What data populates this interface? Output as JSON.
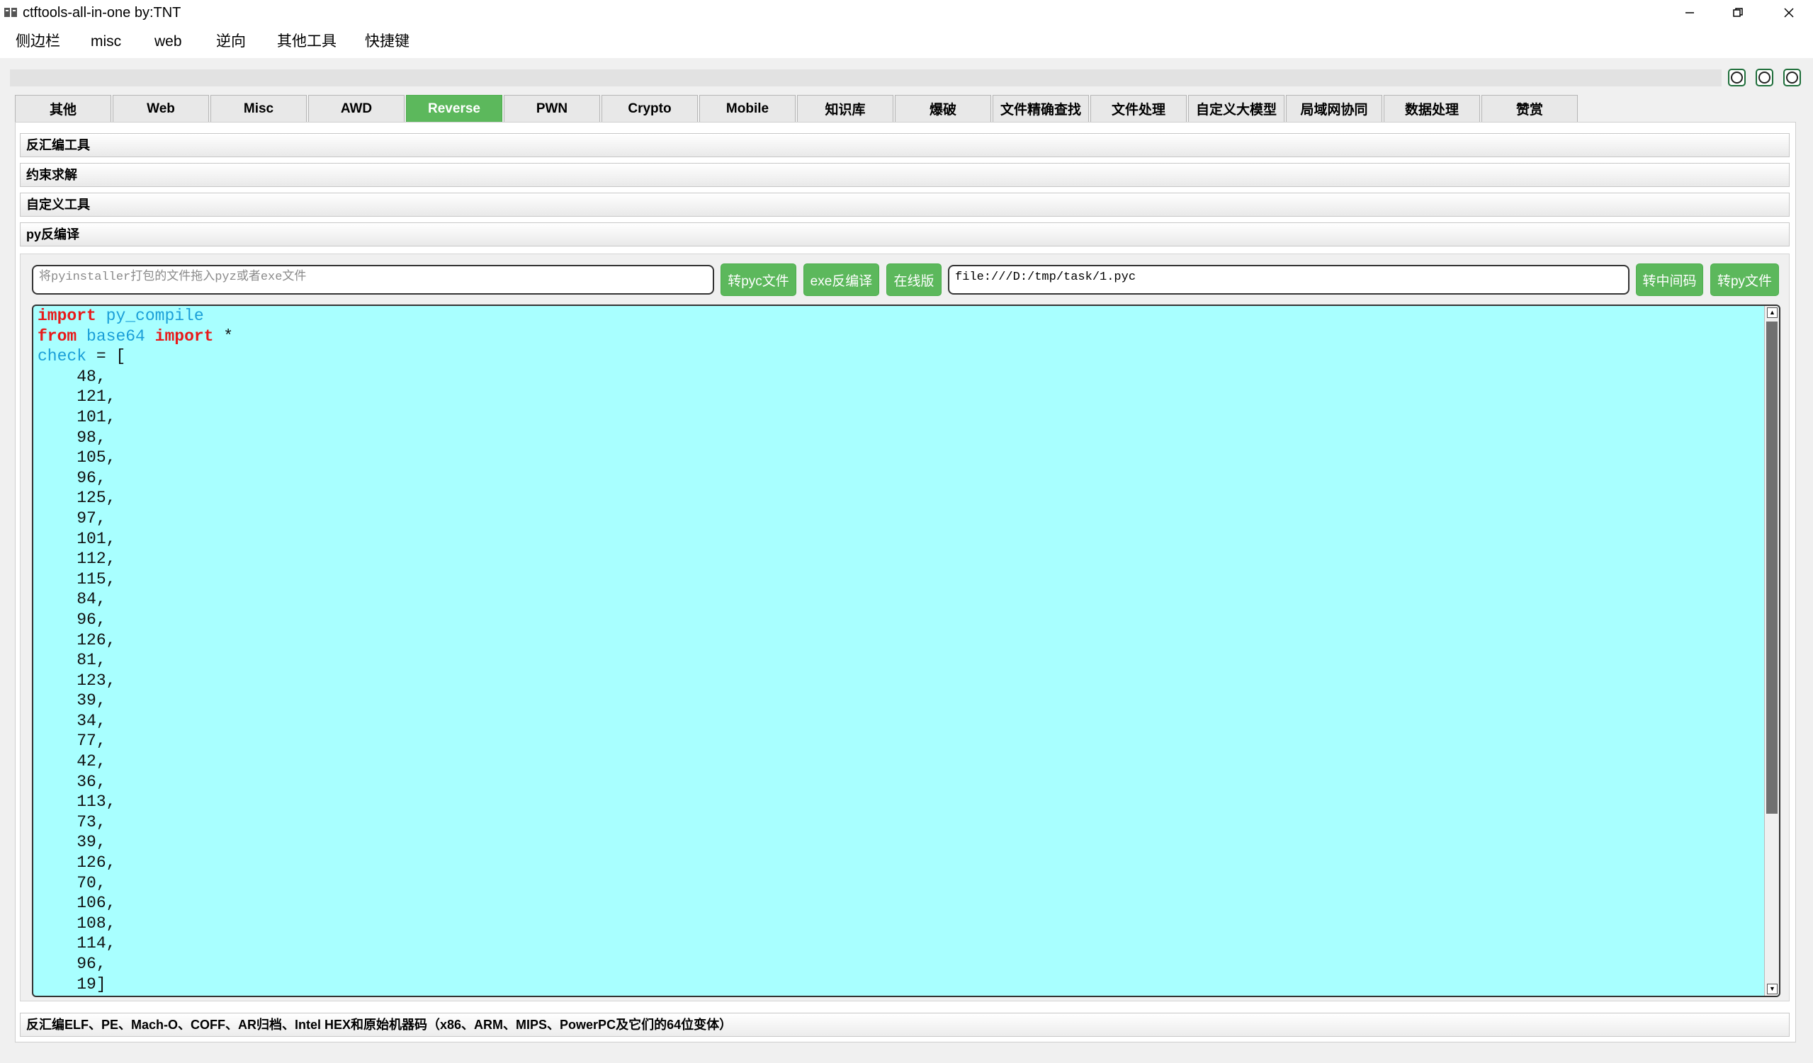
{
  "window": {
    "title": "ctftools-all-in-one   by:TNT"
  },
  "menubar": {
    "items": [
      "侧边栏",
      "misc",
      "web",
      "逆向",
      "其他工具",
      "快捷键"
    ]
  },
  "tabs": [
    "其他",
    "Web",
    "Misc",
    "AWD",
    "Reverse",
    "PWN",
    "Crypto",
    "Mobile",
    "知识库",
    "爆破",
    "文件精确查找",
    "文件处理",
    "自定义大模型",
    "局域网协同",
    "数据处理",
    "赞赏"
  ],
  "active_tab": "Reverse",
  "sections": [
    "反汇编工具",
    "约束求解",
    "自定义工具",
    "py反编译"
  ],
  "py_decompile": {
    "drop_placeholder": "将pyinstaller打包的文件拖入pyz或者exe文件",
    "btn_to_pyc": "转pyc文件",
    "btn_exe_decompile": "exe反编译",
    "btn_online": "在线版",
    "file_path": "file:///D:/tmp/task/1.pyc",
    "btn_to_bytecode": "转中间码",
    "btn_to_py": "转py文件"
  },
  "code": {
    "line1": {
      "kw": "import",
      "id": "py_compile"
    },
    "line2": {
      "kw1": "from",
      "id": "base64",
      "kw2": "import",
      "rest": " *"
    },
    "line3": {
      "id": "check",
      "rest": " = ["
    },
    "values": [
      "    48,",
      "    121,",
      "    101,",
      "    98,",
      "    105,",
      "    96,",
      "    125,",
      "    97,",
      "    101,",
      "    112,",
      "    115,",
      "    84,",
      "    96,",
      "    126,",
      "    81,",
      "    123,",
      "    39,",
      "    34,",
      "    77,",
      "    42,",
      "    36,",
      "    113,",
      "    73,",
      "    39,",
      "    126,",
      "    70,",
      "    106,",
      "    108,",
      "    114,",
      "    96,",
      "    19]"
    ]
  },
  "status_bar": {
    "text": "反汇编ELF、PE、Mach-O、COFF、AR归档、Intel HEX和原始机器码（x86、ARM、MIPS、PowerPC及它们的64位变体）"
  },
  "colors": {
    "accent_green": "#5cb85c",
    "editor_bg": "#a8ffff",
    "keyword": "#e81a1a",
    "identifier": "#1a9fd8"
  }
}
